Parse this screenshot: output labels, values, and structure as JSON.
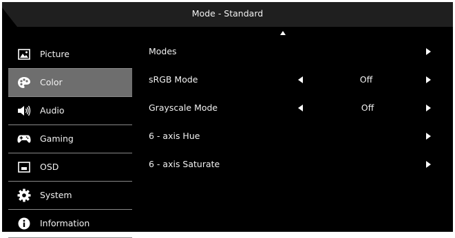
{
  "header": {
    "title": "Mode - Standard"
  },
  "sidebar": {
    "items": [
      {
        "label": "Picture",
        "icon": "picture-icon"
      },
      {
        "label": "Color",
        "icon": "palette-icon",
        "active": true
      },
      {
        "label": "Audio",
        "icon": "speaker-icon"
      },
      {
        "label": "Gaming",
        "icon": "gamepad-icon"
      },
      {
        "label": "OSD",
        "icon": "osd-window-icon"
      },
      {
        "label": "System",
        "icon": "gear-icon"
      },
      {
        "label": "Information",
        "icon": "info-icon"
      }
    ]
  },
  "menu": {
    "rows": [
      {
        "label": "Modes"
      },
      {
        "label": "sRGB Mode",
        "value": "Off"
      },
      {
        "label": "Grayscale Mode",
        "value": "Off"
      },
      {
        "label": "6 - axis Hue"
      },
      {
        "label": "6 - axis Saturate"
      }
    ]
  },
  "colors": {
    "background": "#000000",
    "active_item": "#6e6e6e",
    "text": "#f2f2f2"
  }
}
